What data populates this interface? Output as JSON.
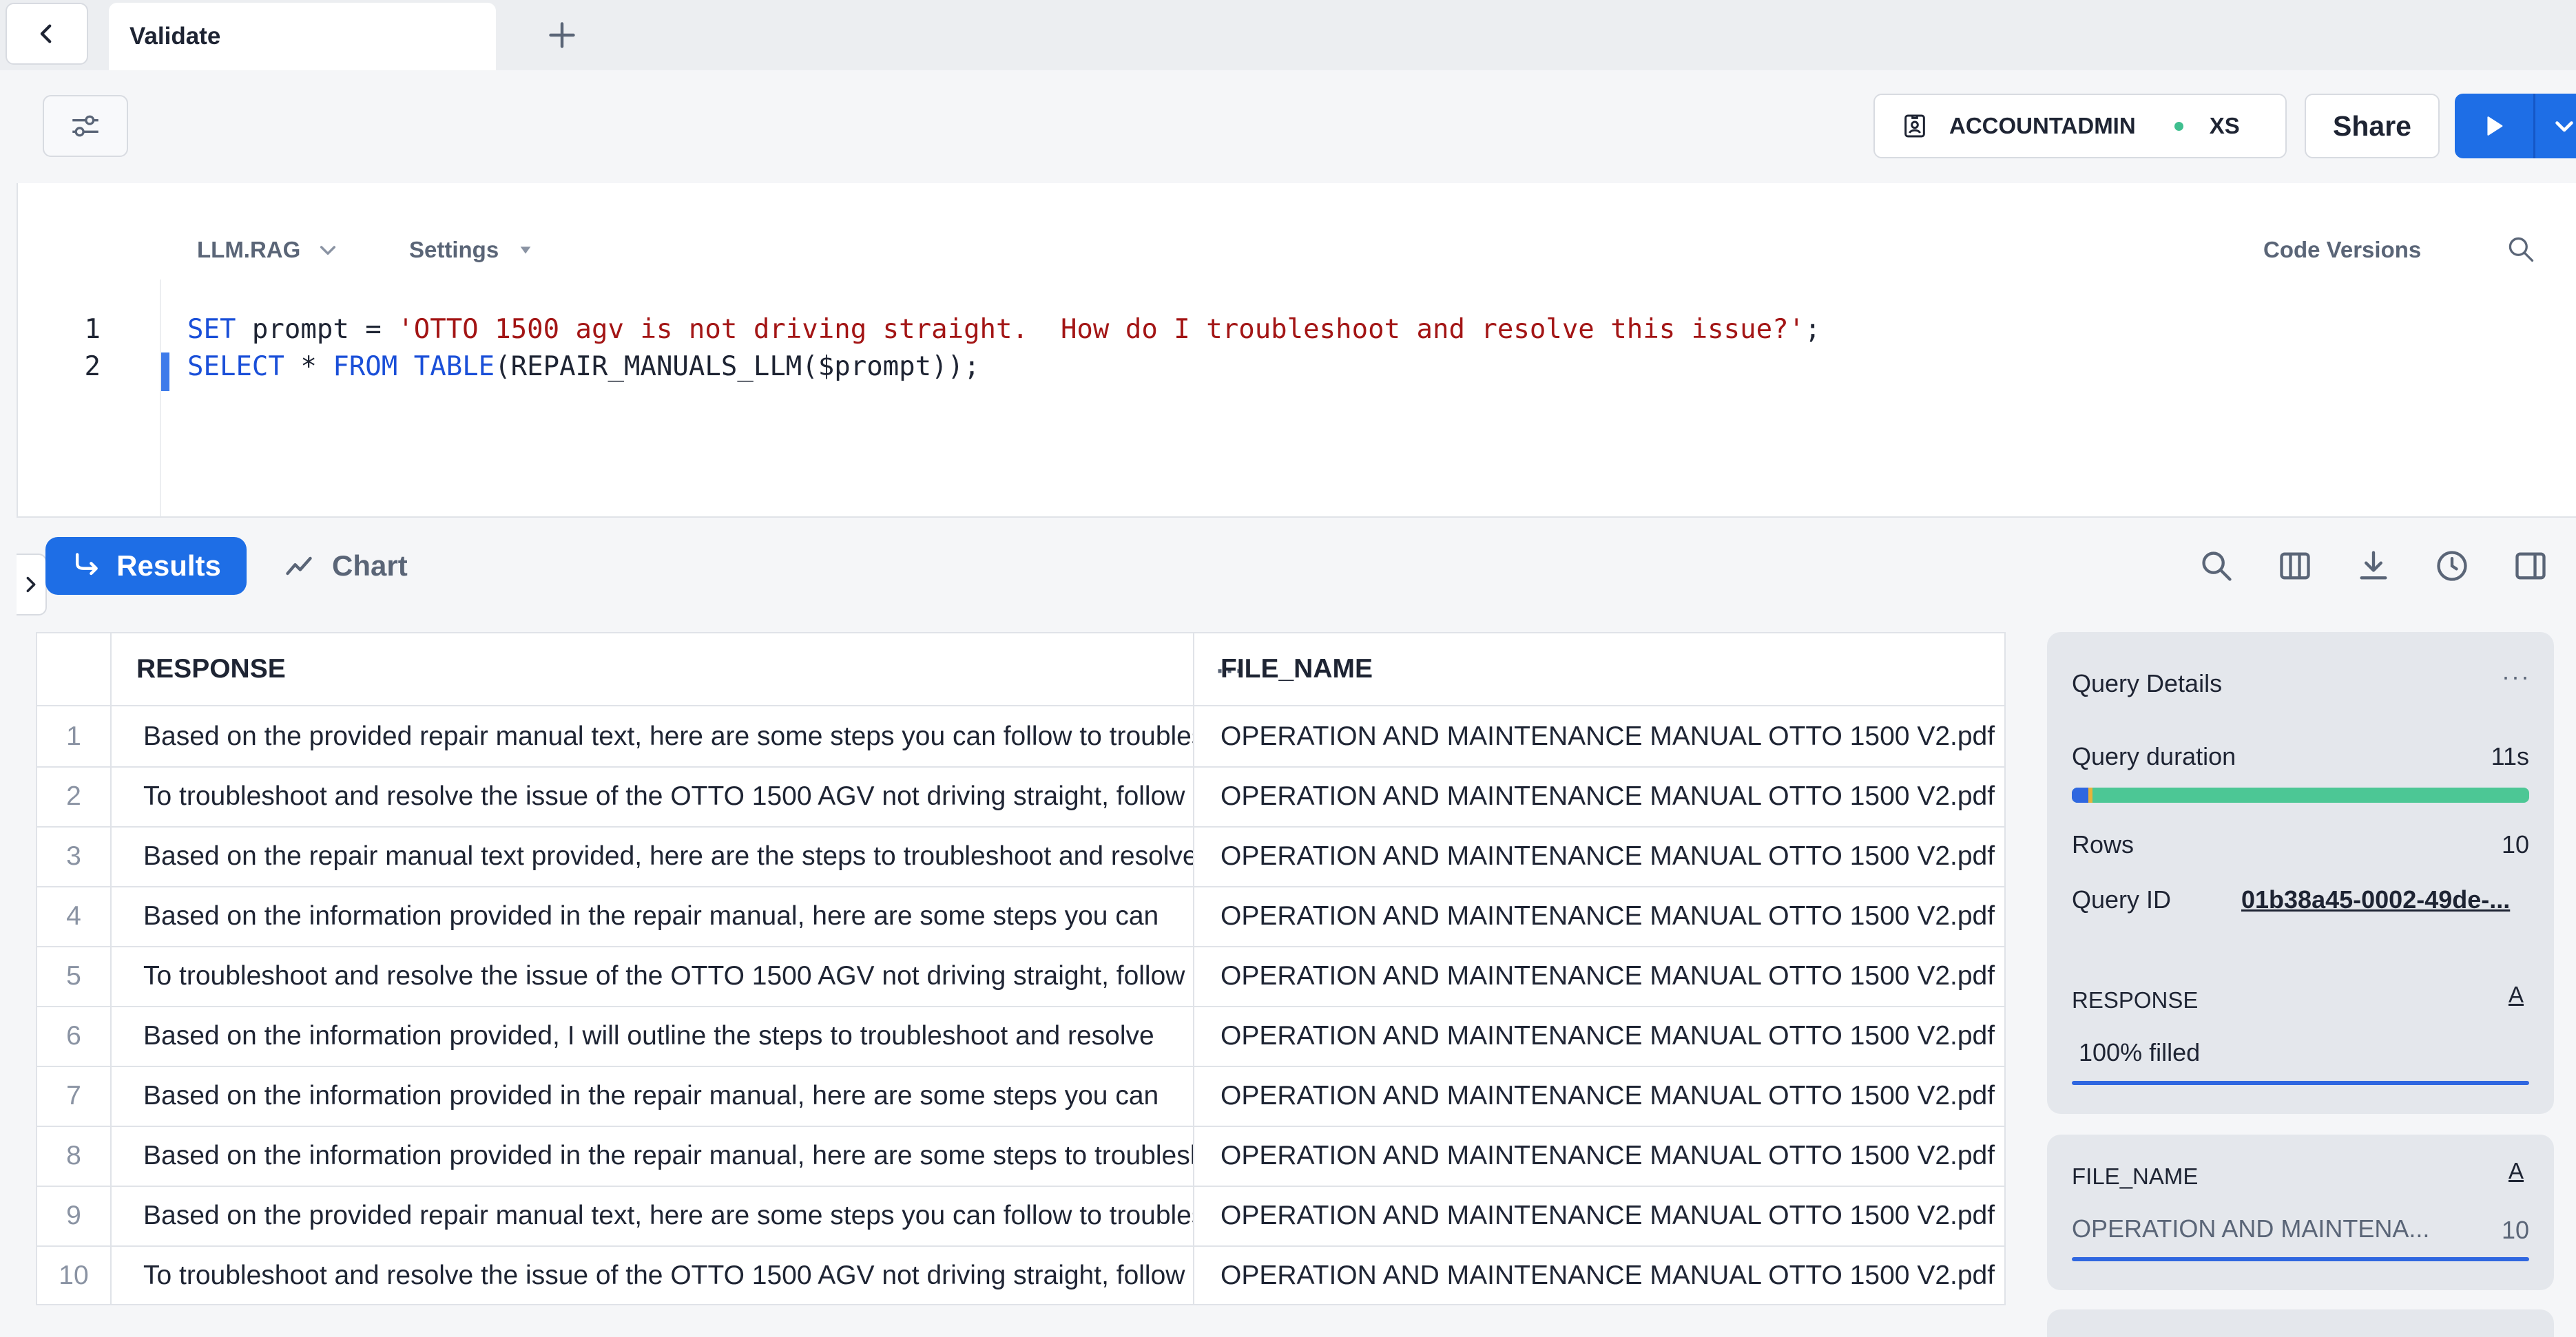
{
  "tabs": {
    "active": "Validate"
  },
  "toolbar": {
    "role": "ACCOUNTADMIN",
    "warehouse_size": "XS",
    "share_label": "Share"
  },
  "editor": {
    "context": "LLM.RAG",
    "settings_label": "Settings",
    "code_versions_label": "Code Versions",
    "lines": [
      {
        "num": "1",
        "kw1": "SET",
        "rest1": " prompt = ",
        "str": "'OTTO 1500 agv is not driving straight.  How do I troubleshoot and resolve this issue?'",
        "rest2": ";"
      },
      {
        "num": "2",
        "kw1": "SELECT",
        "rest1": " * ",
        "kw2": "FROM",
        "sp": " ",
        "kw3": "TABLE",
        "rest2": "(REPAIR_MANUALS_LLM($prompt));"
      }
    ]
  },
  "results": {
    "results_tab": "Results",
    "chart_tab": "Chart",
    "columns": [
      "RESPONSE",
      "FILE_NAME"
    ],
    "rows": [
      {
        "n": "1",
        "response": "Based on the provided repair manual text, here are some steps you can follow to troubleshoot",
        "file": "OPERATION AND MAINTENANCE MANUAL OTTO 1500 V2.pdf"
      },
      {
        "n": "2",
        "response": "To troubleshoot and resolve the issue of the OTTO 1500 AGV not driving straight, follow",
        "file": "OPERATION AND MAINTENANCE MANUAL OTTO 1500 V2.pdf"
      },
      {
        "n": "3",
        "response": "Based on the repair manual text provided, here are the steps to troubleshoot and resolve",
        "file": "OPERATION AND MAINTENANCE MANUAL OTTO 1500 V2.pdf"
      },
      {
        "n": "4",
        "response": "Based on the information provided in the repair manual, here are some steps you can",
        "file": "OPERATION AND MAINTENANCE MANUAL OTTO 1500 V2.pdf"
      },
      {
        "n": "5",
        "response": "To troubleshoot and resolve the issue of the OTTO 1500 AGV not driving straight, follow",
        "file": "OPERATION AND MAINTENANCE MANUAL OTTO 1500 V2.pdf"
      },
      {
        "n": "6",
        "response": "Based on the information provided, I will outline the steps to troubleshoot and resolve",
        "file": "OPERATION AND MAINTENANCE MANUAL OTTO 1500 V2.pdf"
      },
      {
        "n": "7",
        "response": "Based on the information provided in the repair manual, here are some steps you can",
        "file": "OPERATION AND MAINTENANCE MANUAL OTTO 1500 V2.pdf"
      },
      {
        "n": "8",
        "response": "Based on the information provided in the repair manual, here are some steps to troubleshoot",
        "file": "OPERATION AND MAINTENANCE MANUAL OTTO 1500 V2.pdf"
      },
      {
        "n": "9",
        "response": "Based on the provided repair manual text, here are some steps you can follow to troubleshoot",
        "file": "OPERATION AND MAINTENANCE MANUAL OTTO 1500 V2.pdf"
      },
      {
        "n": "10",
        "response": "To troubleshoot and resolve the issue of the OTTO 1500 AGV not driving straight, follow",
        "file": "OPERATION AND MAINTENANCE MANUAL OTTO 1500 V2.pdf"
      }
    ]
  },
  "query_details": {
    "title": "Query Details",
    "duration_label": "Query duration",
    "duration_value": "11s",
    "rows_label": "Rows",
    "rows_value": "10",
    "query_id_label": "Query ID",
    "query_id_value": "01b38a45-0002-49de-..."
  },
  "column_stats": [
    {
      "name": "RESPONSE",
      "type": "A",
      "summary": "100% filled",
      "count": ""
    },
    {
      "name": "FILE_NAME",
      "type": "A",
      "summary": "OPERATION AND MAINTENA...",
      "count": "10"
    }
  ],
  "colors": {
    "accent": "#1e6ee6",
    "keyword": "#1a4fd8",
    "string": "#a31515",
    "status_dot": "#3fbf8f"
  }
}
